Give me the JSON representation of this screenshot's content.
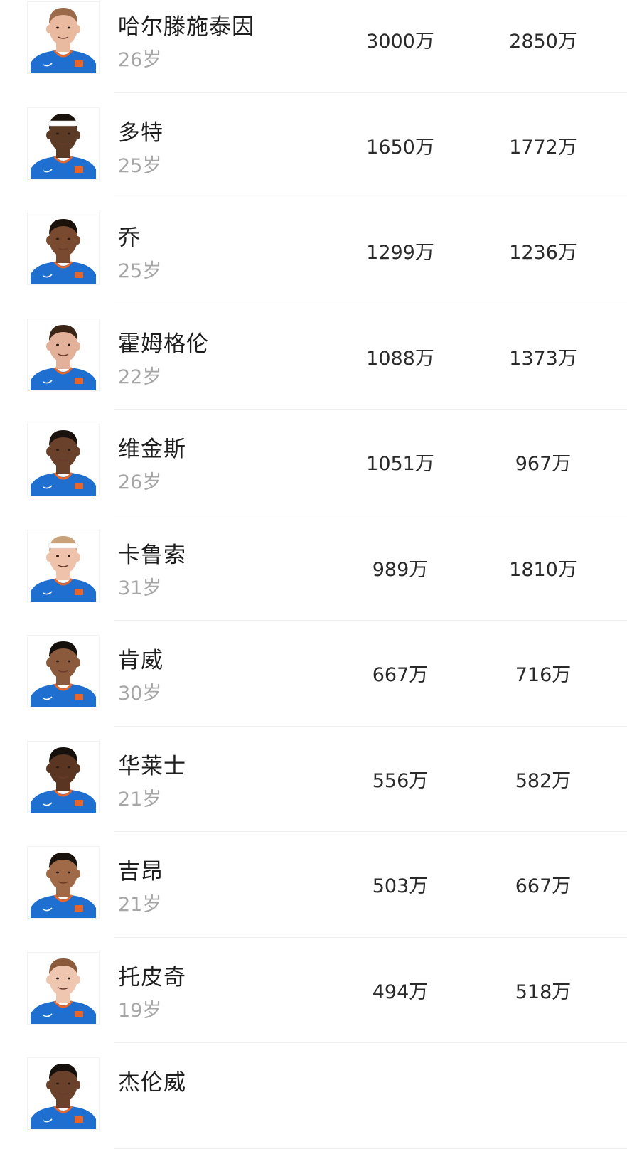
{
  "colors": {
    "jersey_blue": "#1f6fd1",
    "jersey_orange": "#e8662a",
    "name_text": "#1e1e1e",
    "age_text": "#a6a6a6",
    "value_text": "#2a2a2a",
    "divider": "#efefef"
  },
  "players": [
    {
      "name": "哈尔滕施泰因",
      "age": "26岁",
      "value1": "3000万",
      "value2": "2850万",
      "skin": "#e9b9a0",
      "hair": "#9a6a4a",
      "headband": false
    },
    {
      "name": "多特",
      "age": "25岁",
      "value1": "1650万",
      "value2": "1772万",
      "skin": "#5b3a26",
      "hair": "#1a120c",
      "headband": true
    },
    {
      "name": "乔",
      "age": "25岁",
      "value1": "1299万",
      "value2": "1236万",
      "skin": "#7a4a30",
      "hair": "#1b120c",
      "headband": false
    },
    {
      "name": "霍姆格伦",
      "age": "22岁",
      "value1": "1088万",
      "value2": "1373万",
      "skin": "#e3b19a",
      "hair": "#3a2516",
      "headband": false
    },
    {
      "name": "维金斯",
      "age": "26岁",
      "value1": "1051万",
      "value2": "967万",
      "skin": "#6a412a",
      "hair": "#1a120c",
      "headband": false
    },
    {
      "name": "卡鲁索",
      "age": "31岁",
      "value1": "989万",
      "value2": "1810万",
      "skin": "#efc3ab",
      "hair": "#c9a27a",
      "headband": true
    },
    {
      "name": "肯威",
      "age": "30岁",
      "value1": "667万",
      "value2": "716万",
      "skin": "#8b5a3c",
      "hair": "#15100c",
      "headband": false
    },
    {
      "name": "华莱士",
      "age": "21岁",
      "value1": "556万",
      "value2": "582万",
      "skin": "#5a3622",
      "hair": "#15100c",
      "headband": false
    },
    {
      "name": "吉昂",
      "age": "21岁",
      "value1": "503万",
      "value2": "667万",
      "skin": "#a06a48",
      "hair": "#1a120c",
      "headband": false
    },
    {
      "name": "托皮奇",
      "age": "19岁",
      "value1": "494万",
      "value2": "518万",
      "skin": "#efc6b0",
      "hair": "#8a5a3a",
      "headband": false
    },
    {
      "name": "杰伦威",
      "age": "",
      "value1": "",
      "value2": "",
      "skin": "#6a412a",
      "hair": "#15100c",
      "headband": false
    }
  ]
}
